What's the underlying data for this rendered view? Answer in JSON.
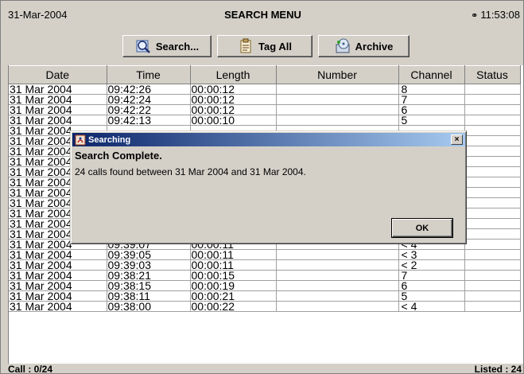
{
  "header": {
    "date": "31-Mar-2004",
    "title": "SEARCH MENU",
    "time": "11:53:08"
  },
  "toolbar": {
    "search_label": "Search...",
    "tag_all_label": "Tag All",
    "archive_label": "Archive"
  },
  "table": {
    "columns": [
      "Date",
      "Time",
      "Length",
      "Number",
      "Channel",
      "Status"
    ],
    "rows": [
      [
        "31 Mar 2004",
        "09:42:26",
        "00:00:12",
        "",
        "8",
        ""
      ],
      [
        "31 Mar 2004",
        "09:42:24",
        "00:00:12",
        "",
        "7",
        ""
      ],
      [
        "31 Mar 2004",
        "09:42:22",
        "00:00:12",
        "",
        "6",
        ""
      ],
      [
        "31 Mar 2004",
        "09:42:13",
        "00:00:10",
        "",
        "5",
        ""
      ],
      [
        "31 Mar 2004",
        "",
        "",
        "",
        "",
        ""
      ],
      [
        "31 Mar 2004",
        "",
        "",
        "",
        "",
        ""
      ],
      [
        "31 Mar 2004",
        "",
        "",
        "",
        "",
        ""
      ],
      [
        "31 Mar 2004",
        "",
        "",
        "",
        "",
        ""
      ],
      [
        "31 Mar 2004",
        "",
        "",
        "",
        "",
        ""
      ],
      [
        "31 Mar 2004",
        "",
        "",
        "",
        "",
        ""
      ],
      [
        "31 Mar 2004",
        "",
        "",
        "",
        "",
        ""
      ],
      [
        "31 Mar 2004",
        "",
        "",
        "",
        "",
        ""
      ],
      [
        "31 Mar 2004",
        "09:39:45",
        "00:00:13",
        "",
        "< 4",
        ""
      ],
      [
        "31 Mar 2004",
        "09:39:36",
        "00:00:19",
        "",
        "< 2",
        ""
      ],
      [
        "31 Mar 2004",
        "09:39:13",
        "00:00:11",
        "",
        "5",
        ""
      ],
      [
        "31 Mar 2004",
        "09:39:07",
        "00:00:11",
        "",
        "< 4",
        ""
      ],
      [
        "31 Mar 2004",
        "09:39:05",
        "00:00:11",
        "",
        "< 3",
        ""
      ],
      [
        "31 Mar 2004",
        "09:39:03",
        "00:00:11",
        "",
        "< 2",
        ""
      ],
      [
        "31 Mar 2004",
        "09:38:21",
        "00:00:15",
        "",
        "7",
        ""
      ],
      [
        "31 Mar 2004",
        "09:38:15",
        "00:00:19",
        "",
        "6",
        ""
      ],
      [
        "31 Mar 2004",
        "09:38:11",
        "00:00:21",
        "",
        "5",
        ""
      ],
      [
        "31 Mar 2004",
        "09:38:00",
        "00:00:22",
        "",
        "< 4",
        ""
      ]
    ]
  },
  "status": {
    "call": "Call : 0/24",
    "listed": "Listed : 24"
  },
  "dialog": {
    "title": "Searching",
    "heading": "Search Complete.",
    "message": "24 calls found between 31 Mar 2004 and 31 Mar 2004.",
    "ok_label": "OK",
    "close_label": "×"
  }
}
